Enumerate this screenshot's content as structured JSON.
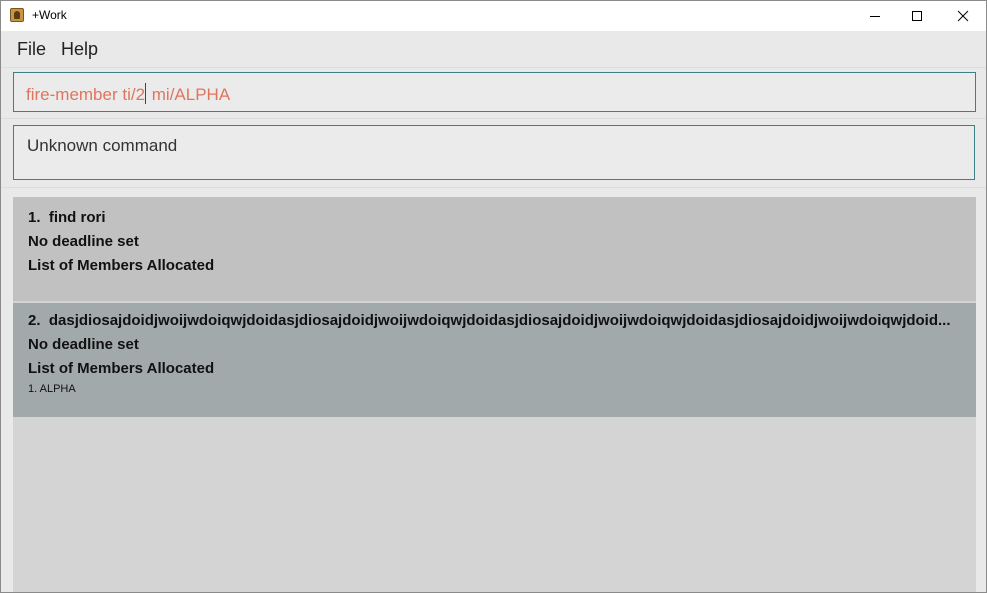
{
  "window": {
    "title": "+Work"
  },
  "menu": {
    "items": [
      "File",
      "Help"
    ]
  },
  "command": {
    "text_before_caret": "fire-member ti/2",
    "text_after_caret": " mi/ALPHA",
    "color": "#e0755f"
  },
  "result": {
    "text": "Unknown command"
  },
  "tasks": [
    {
      "index": "1.",
      "name": "find rori",
      "deadline": "No deadline set",
      "members_label": "List of Members Allocated",
      "members": []
    },
    {
      "index": "2.",
      "name": "dasjdiosajdoidjwoijwdoiqwjdoidasjdiosajdoidjwoijwdoiqwjdoidasjdiosajdoidjwoijwdoiqwjdoidasjdiosajdoidjwoijwdoiqwjdoid...",
      "deadline": "No deadline set",
      "members_label": "List of Members Allocated",
      "members": [
        "1. ALPHA"
      ]
    }
  ],
  "colors": {
    "accent_border": "#3f7f86",
    "card_default": "#c1c1c1",
    "card_selected": "#a2a9ab"
  },
  "icons": {
    "app": "app-icon",
    "minimize": "minimize-icon",
    "maximize": "maximize-icon",
    "close": "close-icon"
  }
}
